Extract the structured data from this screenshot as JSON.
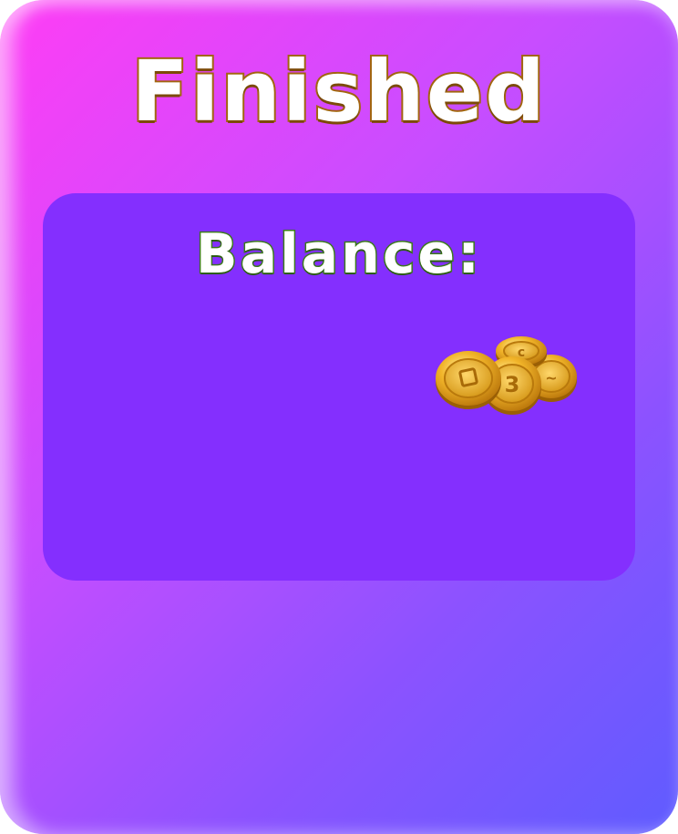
{
  "dialog": {
    "title": "Finished",
    "balance_label": "Balance:",
    "balance_icon": "gold-coins-icon"
  },
  "colors": {
    "background_start": "#ff3df5",
    "background_end": "#5f5cff",
    "panel": "#842ffe",
    "title_outline": "#a2650f",
    "balance_outline": "#3c7a1b",
    "coin_gold": "#f2b52a"
  }
}
